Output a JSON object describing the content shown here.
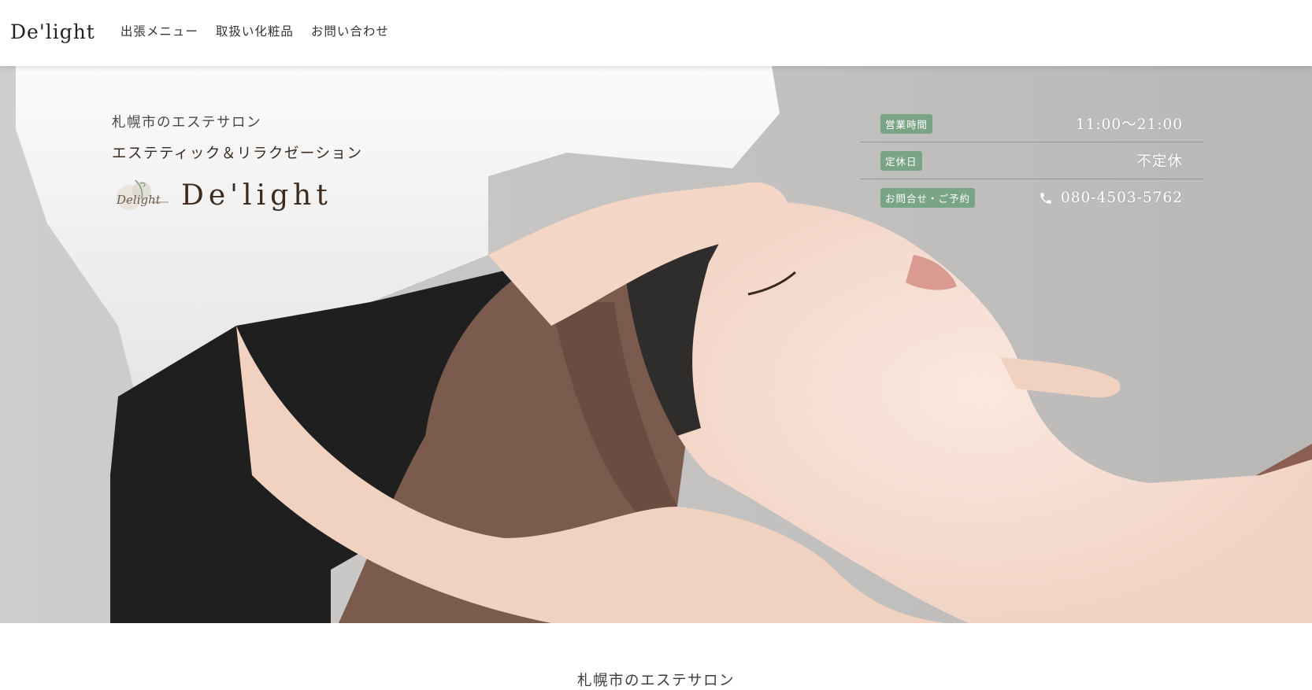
{
  "header": {
    "logo": "De'light",
    "nav": [
      {
        "label": "出張メニュー"
      },
      {
        "label": "取扱い化粧品"
      },
      {
        "label": "お問い合わせ"
      }
    ]
  },
  "hero": {
    "sub1": "札幌市のエステサロン",
    "sub2": "エステティック＆リラクゼーション",
    "brand": "De'light",
    "brand_mark_text": "Delight"
  },
  "info": {
    "hours_label": "営業時間",
    "hours_value": "11:00〜21:00",
    "holiday_label": "定休日",
    "holiday_value": "不定休",
    "contact_label": "お問合せ・ご予約",
    "contact_value": "080-4503-5762",
    "contact_icon": "phone-icon"
  },
  "section": {
    "title": "札幌市のエステサロン"
  },
  "colors": {
    "badge": "#7aa486",
    "towel": "#7a5b4e",
    "background": "#c4c3c1"
  }
}
